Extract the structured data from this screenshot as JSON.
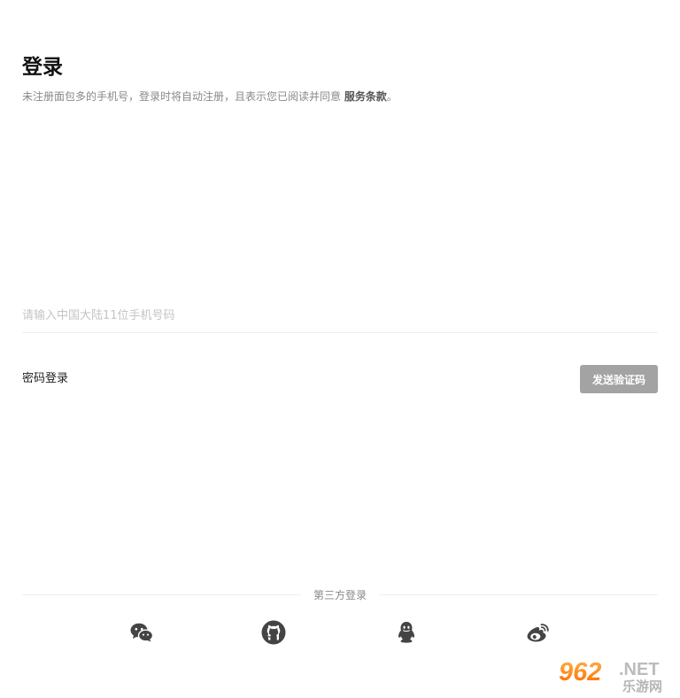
{
  "login": {
    "title": "登录",
    "notice_text": "未注册面包多的手机号，登录时将自动注册，且表示您已阅读并同意 ",
    "terms_link": "服务条款",
    "notice_end": "。"
  },
  "phone": {
    "placeholder": "请输入中国大陆11位手机号码",
    "value": ""
  },
  "actions": {
    "password_login": "密码登录",
    "send_code": "发送验证码"
  },
  "third_party": {
    "label": "第三方登录",
    "providers": [
      {
        "name": "wechat",
        "icon": "wechat-icon"
      },
      {
        "name": "github",
        "icon": "github-icon"
      },
      {
        "name": "qq",
        "icon": "qq-icon"
      },
      {
        "name": "weibo",
        "icon": "weibo-icon"
      }
    ]
  },
  "watermark": {
    "brand_number": "962",
    "brand_suffix": ".NET",
    "brand_cn": "乐游网"
  },
  "colors": {
    "button_bg": "#a3a3a3",
    "icon": "#444444",
    "muted_text": "#888888"
  }
}
